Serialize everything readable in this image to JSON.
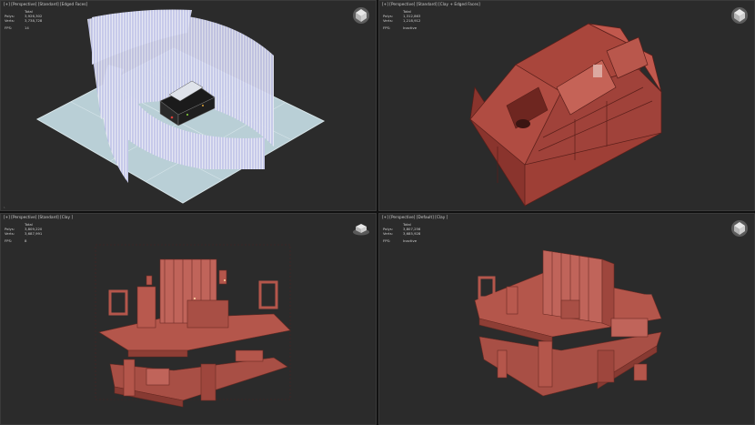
{
  "viewports": [
    {
      "label": "[+] [Perspective] [Standard] [Edged Faces]",
      "stats_title": "Total",
      "polys_label": "Polys:",
      "polys_value": "3,926,302",
      "verts_label": "Verts:",
      "verts_value": "3,738,728",
      "fps_label": "FPS:",
      "fps_value": "14",
      "viewcube_icon": "viewcube-icon"
    },
    {
      "label": "[+] [Perspective] [Standard] [Clay + Edged Faces]",
      "stats_title": "Total",
      "polys_label": "Polys:",
      "polys_value": "1,312,863",
      "verts_label": "Verts:",
      "verts_value": "1,218,912",
      "fps_label": "FPS:",
      "fps_value": "Inactive",
      "viewcube_icon": "viewcube-icon"
    },
    {
      "label": "[+] [Perspective] [Standard] [Clay ]",
      "stats_title": "Total",
      "polys_label": "Polys:",
      "polys_value": "3,809,220",
      "verts_label": "Verts:",
      "verts_value": "3,687,991",
      "fps_label": "FPS:",
      "fps_value": "8",
      "viewcube_icon": "viewcube-icon"
    },
    {
      "label": "[+] [Perspective] [Default] [Clay ]",
      "stats_title": "Total",
      "polys_label": "Polys:",
      "polys_value": "3,807,256",
      "verts_label": "Verts:",
      "verts_value": "3,685,928",
      "fps_label": "FPS:",
      "fps_value": "Inactive",
      "viewcube_icon": "viewcube-icon"
    }
  ],
  "colors": {
    "viewport_bg": "#2b2b2b",
    "clay": "#b4564b",
    "ground": "#b7cfd6",
    "panel_lines": "#8f93d8"
  }
}
